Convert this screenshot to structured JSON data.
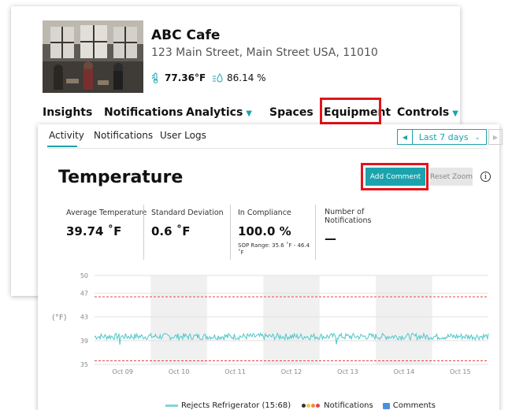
{
  "store": {
    "name": "ABC Cafe",
    "address": "123 Main Street, Main Street USA, 11010",
    "temperature": "77.36°F",
    "humidity": "86.14 %"
  },
  "nav": [
    {
      "label": "Insights",
      "dropdown": false
    },
    {
      "label": "Notifications",
      "dropdown": false
    },
    {
      "label": "Analytics",
      "dropdown": true
    },
    {
      "label": "Spaces",
      "dropdown": false
    },
    {
      "label": "Equipment",
      "dropdown": false,
      "highlighted": true
    },
    {
      "label": "Controls",
      "dropdown": true
    }
  ],
  "tabs": [
    {
      "label": "Activity",
      "active": true
    },
    {
      "label": "Notifications",
      "active": false
    },
    {
      "label": "User Logs",
      "active": false
    }
  ],
  "date_range": {
    "label": "Last 7 days"
  },
  "panel": {
    "title": "Temperature",
    "add_comment": "Add Comment",
    "reset_zoom": "Reset Zoom",
    "info": "i"
  },
  "stats": [
    {
      "label": "Average Temperature",
      "value": "39.74 ˚F"
    },
    {
      "label": "Standard Deviation",
      "value": "0.6 ˚F"
    },
    {
      "label": "In Compliance",
      "value": "100.0 %",
      "note": "SOP Range: 35.6 ˚F - 46.4 ˚F"
    },
    {
      "label": "Number of Notifications",
      "value": "—"
    }
  ],
  "chart_data": {
    "type": "line",
    "ylabel": "(°F)",
    "ylim": [
      35,
      50
    ],
    "yticks": [
      35,
      39,
      43,
      47,
      50
    ],
    "xticks": [
      "Oct 09",
      "Oct 10",
      "Oct 11",
      "Oct 12",
      "Oct 13",
      "Oct 14",
      "Oct 15"
    ],
    "sop_range": [
      35.6,
      46.4
    ],
    "series": [
      {
        "name": "Rejects Refrigerator (15:68)",
        "color": "#4fc7c9",
        "baseline": 39.7,
        "noise": 0.55,
        "dips": [
          {
            "day": 0.45,
            "value": 38.3
          },
          {
            "day": 4.3,
            "value": 38.4
          }
        ]
      }
    ]
  },
  "legend": {
    "series_label": "Rejects Refrigerator (15:68)",
    "notifications_label": "Notifications",
    "comments_label": "Comments"
  },
  "colors": {
    "accent": "#1aa3ad",
    "highlight": "#e3141b",
    "sop_line": "#e24444"
  }
}
